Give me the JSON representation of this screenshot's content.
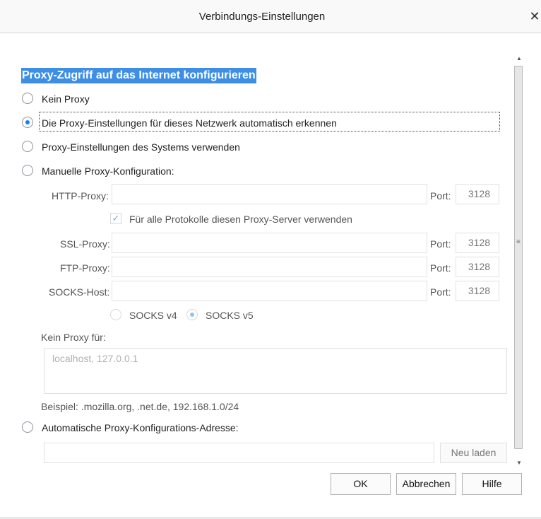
{
  "window": {
    "title": "Verbindungs-Einstellungen",
    "close_glyph": "✕"
  },
  "heading": "Proxy-Zugriff auf das Internet konfigurieren",
  "options": {
    "no_proxy": "Kein Proxy",
    "auto_detect": "Die Proxy-Einstellungen für dieses Netzwerk automatisch erkennen",
    "system": "Proxy-Einstellungen des Systems verwenden",
    "manual": "Manuelle Proxy-Konfiguration:",
    "pac": "Automatische Proxy-Konfigurations-Adresse:"
  },
  "selected_option": "auto_detect",
  "manual": {
    "http_label": "HTTP-Proxy:",
    "http_value": "",
    "http_port_label": "Port:",
    "http_port": "3128",
    "share_label": "Für alle Protokolle diesen Proxy-Server verwenden",
    "share_checked": true,
    "ssl_label": "SSL-Proxy:",
    "ssl_value": "",
    "ssl_port_label": "Port:",
    "ssl_port": "3128",
    "ftp_label": "FTP-Proxy:",
    "ftp_value": "",
    "ftp_port_label": "Port:",
    "ftp_port": "3128",
    "socks_label": "SOCKS-Host:",
    "socks_value": "",
    "socks_port_label": "Port:",
    "socks_port": "3128",
    "socks_v4": "SOCKS v4",
    "socks_v5": "SOCKS v5",
    "socks_selected": "v5"
  },
  "no_proxy_for": {
    "label": "Kein Proxy für:",
    "value": "localhost, 127.0.0.1",
    "example": "Beispiel: .mozilla.org, .net.de, 192.168.1.0/24"
  },
  "pac": {
    "url_value": "",
    "reload_label": "Neu laden"
  },
  "buttons": {
    "ok": "OK",
    "cancel": "Abbrechen",
    "help": "Hilfe"
  },
  "icons": {
    "close": "close-icon",
    "check": "checkmark-icon",
    "scroll_up": "scroll-up-icon",
    "scroll_down": "scroll-down-icon"
  }
}
